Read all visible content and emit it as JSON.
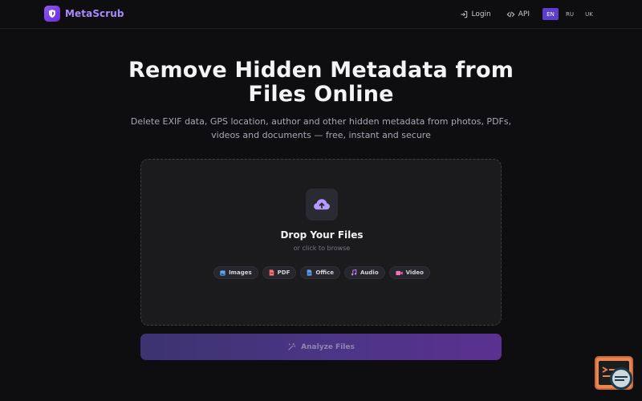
{
  "brand": {
    "name": "MetaScrub",
    "logo_icon": "shield-icon",
    "accent": "#8b5cf6"
  },
  "nav": {
    "login": "Login",
    "api": "API",
    "languages": [
      {
        "code": "EN",
        "active": true
      },
      {
        "code": "RU",
        "active": false
      },
      {
        "code": "UK",
        "active": false
      }
    ]
  },
  "hero": {
    "title": "Remove Hidden Metadata from Files Online",
    "subtitle": "Delete EXIF data, GPS location, author and other hidden metadata from photos, PDFs, videos and documents — free, instant and secure"
  },
  "dropzone": {
    "icon": "cloud-upload-icon",
    "title": "Drop Your Files",
    "hint": "or click to browse",
    "file_types": [
      {
        "label": "Images",
        "icon": "image-icon",
        "color": "#60a5fa"
      },
      {
        "label": "PDF",
        "icon": "pdf-icon",
        "color": "#f87171"
      },
      {
        "label": "Office",
        "icon": "document-icon",
        "color": "#60a5fa"
      },
      {
        "label": "Audio",
        "icon": "music-icon",
        "color": "#c084fc"
      },
      {
        "label": "Video",
        "icon": "video-icon",
        "color": "#f472b6"
      }
    ]
  },
  "action": {
    "label": "Analyze Files",
    "icon": "magic-wand-icon"
  }
}
